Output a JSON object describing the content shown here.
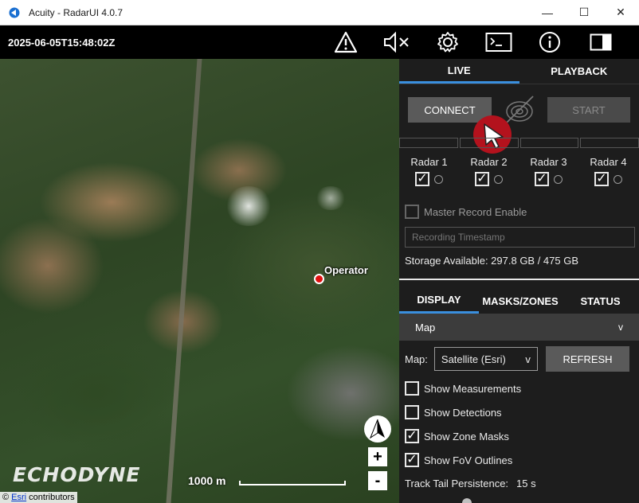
{
  "window": {
    "title": "Acuity - RadarUI 4.0.7",
    "controls": {
      "minimize": "—",
      "maximize": "☐",
      "close": "✕"
    }
  },
  "toolbar": {
    "timestamp": "2025-06-05T15:48:02Z",
    "icons": [
      "warning-icon",
      "mute-icon",
      "gear-icon",
      "terminal-icon",
      "info-icon",
      "panel-toggle-icon"
    ]
  },
  "map": {
    "operator_label": "Operator",
    "brand": "ECHODYNE",
    "scale_text": "1000 m",
    "zoom_in": "+",
    "zoom_out": "-",
    "attribution_symbol": "©",
    "attribution_link": "Esri",
    "attribution_rest": " contributors"
  },
  "panel": {
    "tabs": {
      "live": "LIVE",
      "playback": "PLAYBACK"
    },
    "connect_label": "CONNECT",
    "start_label": "START",
    "radars": [
      {
        "label": "Radar 1",
        "checked": true
      },
      {
        "label": "Radar 2",
        "checked": true
      },
      {
        "label": "Radar 3",
        "checked": true
      },
      {
        "label": "Radar 4",
        "checked": true
      }
    ],
    "master_record_label": "Master Record Enable",
    "recording_placeholder": "Recording Timestamp",
    "storage_text": "Storage Available: 297.8 GB / 475 GB",
    "sub_tabs": {
      "display": "DISPLAY",
      "masks": "MASKS/ZONES",
      "status": "STATUS"
    },
    "section_title": "Map",
    "section_chevron": "v",
    "map_label": "Map:",
    "map_select_value": "Satellite (Esri)",
    "map_select_chevron": "v",
    "refresh_label": "REFRESH",
    "options": [
      {
        "label": "Show Measurements",
        "checked": false
      },
      {
        "label": "Show Detections",
        "checked": false
      },
      {
        "label": "Show Zone Masks",
        "checked": true
      },
      {
        "label": "Show FoV Outlines",
        "checked": true
      }
    ],
    "tail_label": "Track Tail Persistence:",
    "tail_value": "15 s"
  },
  "colors": {
    "accent": "#3a8fde",
    "operator": "#e01010",
    "cursor_badge": "#b3121d"
  }
}
